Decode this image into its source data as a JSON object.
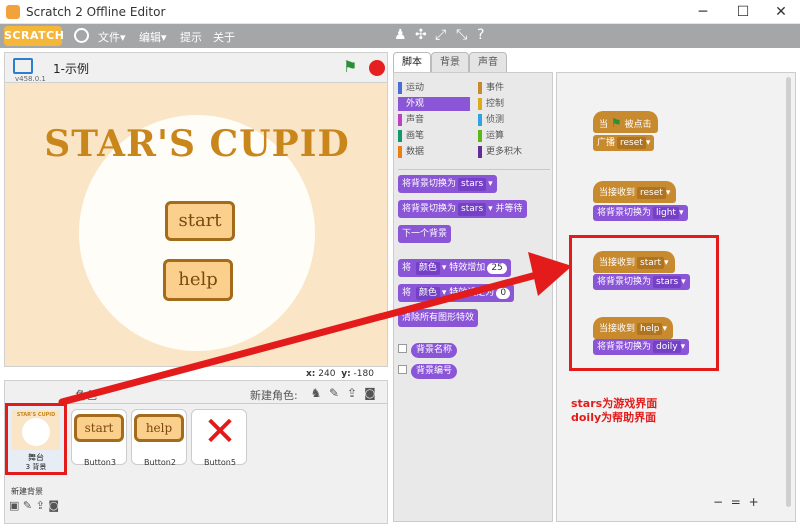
{
  "window": {
    "title": "Scratch 2 Offline Editor",
    "minimize": "─",
    "maximize": "☐",
    "close": "✕"
  },
  "menubar": {
    "logo": "SCRATCH",
    "items": [
      "文件▾",
      "编辑▾",
      "提示",
      "关于"
    ],
    "tools": [
      "duplicate-icon",
      "cut-icon",
      "grow-icon",
      "shrink-icon",
      "help-icon"
    ],
    "tool_glyphs": [
      "♟",
      "✣",
      "⤢",
      "⤡",
      "?"
    ]
  },
  "stage": {
    "project_name": "1-示例",
    "version": "v458.0.1",
    "game_title": "STAR'S CUPID",
    "start_label": "start",
    "help_label": "help",
    "x_label": "x:",
    "x_value": "240",
    "y_label": "y:",
    "y_value": "-180"
  },
  "sprites": {
    "role_label": "角色",
    "new_sprite_label": "新建角色:",
    "stage_thumb": {
      "name": "舞台",
      "bg_count": "3 背景",
      "mini_title": "STAR'S CUPID"
    },
    "new_bg_label": "新建背景",
    "cards": [
      {
        "name": "Button3",
        "face": "start"
      },
      {
        "name": "Button2",
        "face": "help"
      },
      {
        "name": "Button5",
        "face": "✕"
      }
    ]
  },
  "tabs": [
    "脚本",
    "背景",
    "声音"
  ],
  "categories": [
    {
      "label": "运动",
      "color": "#4a6cd4"
    },
    {
      "label": "事件",
      "color": "#c88a2e"
    },
    {
      "label": "外观",
      "color": "#8a55d7"
    },
    {
      "label": "控制",
      "color": "#e1a91a"
    },
    {
      "label": "声音",
      "color": "#bb42c3"
    },
    {
      "label": "侦测",
      "color": "#2ca5e2"
    },
    {
      "label": "画笔",
      "color": "#0e9a6c"
    },
    {
      "label": "运算",
      "color": "#5cb712"
    },
    {
      "label": "数据",
      "color": "#ee7d16"
    },
    {
      "label": "更多积木",
      "color": "#632d99"
    }
  ],
  "palette": {
    "b1": {
      "text": "将背景切换为",
      "drop": "stars"
    },
    "b2": {
      "text": "将背景切换为",
      "drop": "stars",
      "tail": "并等待"
    },
    "b3": {
      "text": "下一个背景"
    },
    "b4": {
      "pre": "将",
      "drop": "颜色",
      "mid": "特效增加",
      "num": "25"
    },
    "b5": {
      "pre": "将",
      "drop": "颜色",
      "mid": "特效设定为",
      "num": "0"
    },
    "b6": {
      "text": "清除所有图形特效"
    },
    "r1": "背景名称",
    "r2": "背景编号"
  },
  "scripts": {
    "s1_hat_pre": "当",
    "s1_hat_post": "被点击",
    "s1_b": {
      "text": "广播",
      "drop": "reset"
    },
    "s2_hat": {
      "text": "当接收到",
      "drop": "reset"
    },
    "s2_b": {
      "text": "将背景切换为",
      "drop": "light"
    },
    "s3_hat": {
      "text": "当接收到",
      "drop": "start"
    },
    "s3_b": {
      "text": "将背景切换为",
      "drop": "stars"
    },
    "s4_hat": {
      "text": "当接收到",
      "drop": "help"
    },
    "s4_b": {
      "text": "将背景切换为",
      "drop": "doily"
    }
  },
  "annotation": [
    "stars为游戏界面",
    "doily为帮助界面"
  ],
  "zoom": [
    "−",
    "=",
    "+"
  ],
  "accent": {
    "highlight": "#e31b1b",
    "looks": "#8a55d7",
    "events": "#c88a2e"
  }
}
